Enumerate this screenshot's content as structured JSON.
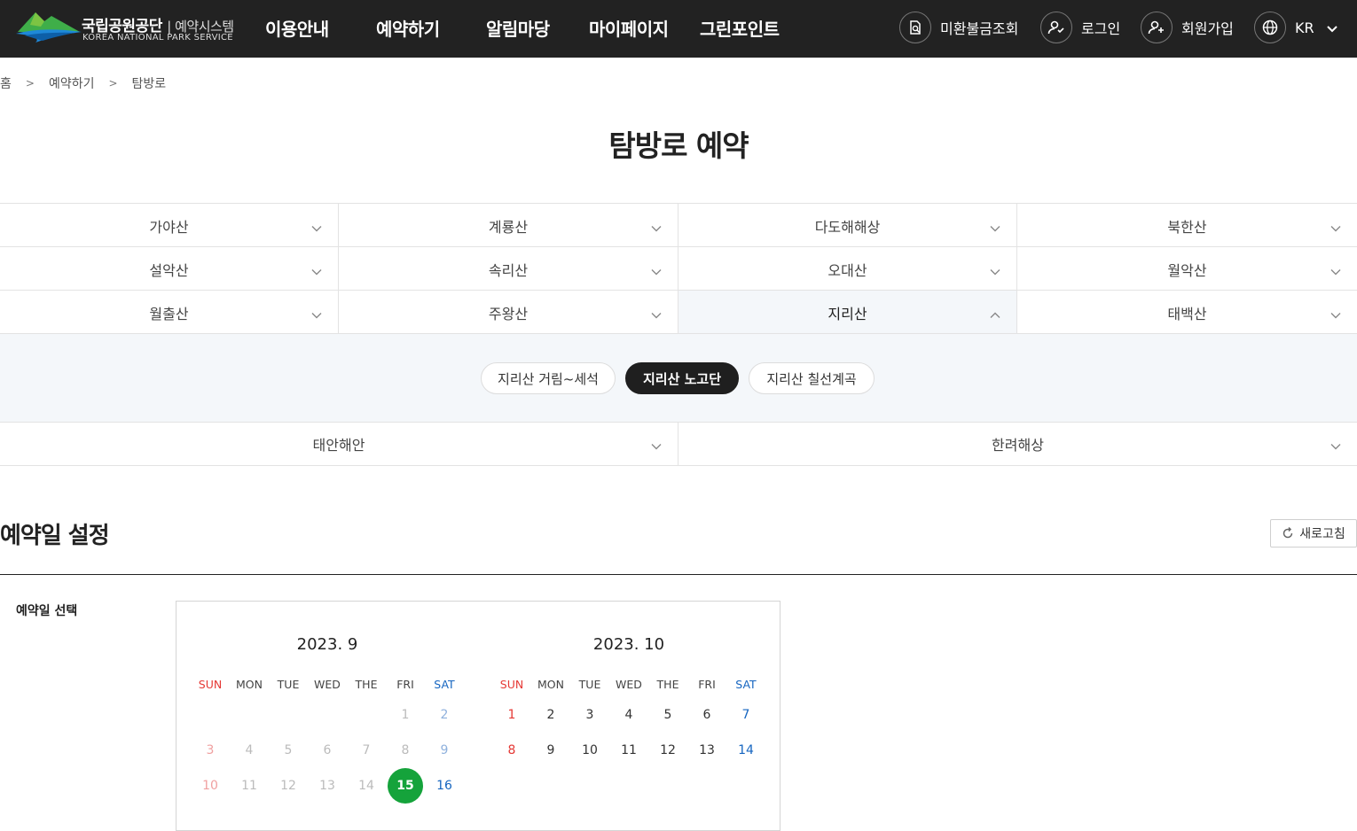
{
  "header": {
    "logo_ko": "국립공원공단",
    "logo_sub": "| 예약시스템",
    "logo_en": "KOREA NATIONAL PARK SERVICE",
    "nav": [
      "이용안내",
      "예약하기",
      "알림마당",
      "마이페이지",
      "그린포인트"
    ],
    "unpaid_label": "미환불금조회",
    "login_label": "로그인",
    "signup_label": "회원가입",
    "lang_label": "KR"
  },
  "breadcrumb": [
    "홈",
    "예약하기",
    "탐방로"
  ],
  "page_title": "탐방로 예약",
  "parks": {
    "row1": [
      "가야산",
      "계룡산",
      "다도해해상",
      "북한산"
    ],
    "row2": [
      "설악산",
      "속리산",
      "오대산",
      "월악산"
    ],
    "row3": [
      "월출산",
      "주왕산",
      "지리산",
      "태백산"
    ],
    "row4": [
      "태안해안",
      "한려해상"
    ],
    "active": "지리산"
  },
  "trails": {
    "items": [
      "지리산 거림~세석",
      "지리산 노고단",
      "지리산 칠선계곡"
    ],
    "selected": "지리산 노고단"
  },
  "reservation": {
    "section_title": "예약일 설정",
    "refresh_label": "새로고침",
    "field_label": "예약일 선택"
  },
  "calendar": {
    "weekdays": [
      "SUN",
      "MON",
      "TUE",
      "WED",
      "THE",
      "FRI",
      "SAT"
    ],
    "months": [
      {
        "title": "2023. 9",
        "rows": [
          [
            "",
            "",
            "",
            "",
            "",
            "1",
            "2"
          ],
          [
            "3",
            "4",
            "5",
            "6",
            "7",
            "8",
            "9"
          ],
          [
            "10",
            "11",
            "12",
            "13",
            "14",
            "15",
            "16"
          ]
        ],
        "past_until": 14,
        "today": "15"
      },
      {
        "title": "2023. 10",
        "rows": [
          [
            "1",
            "2",
            "3",
            "4",
            "5",
            "6",
            "7"
          ],
          [
            "8",
            "9",
            "10",
            "11",
            "12",
            "13",
            "14"
          ]
        ],
        "past_until": 0,
        "today": ""
      }
    ]
  },
  "colors": {
    "header_bg": "#222222",
    "accent_green": "#15a33b",
    "sunday_red": "#e53935",
    "saturday_blue": "#1565c0"
  }
}
